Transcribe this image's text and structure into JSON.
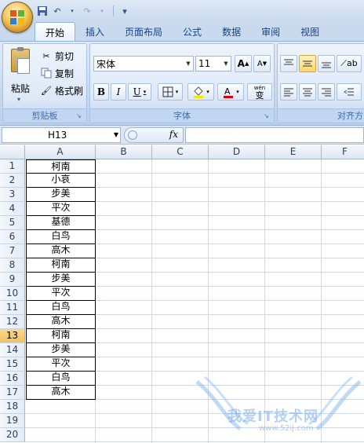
{
  "quick_access": {
    "save": "save-icon",
    "undo": "↶",
    "redo": "↷",
    "customize": "▾"
  },
  "tabs": [
    {
      "label": "开始",
      "active": true
    },
    {
      "label": "插入",
      "active": false
    },
    {
      "label": "页面布局",
      "active": false
    },
    {
      "label": "公式",
      "active": false
    },
    {
      "label": "数据",
      "active": false
    },
    {
      "label": "审阅",
      "active": false
    },
    {
      "label": "视图",
      "active": false
    }
  ],
  "clipboard": {
    "paste": "粘贴",
    "cut": "剪切",
    "copy": "复制",
    "format_painter": "格式刷",
    "title": "剪贴板"
  },
  "font": {
    "name": "宋体",
    "size": "11",
    "title": "字体",
    "grow": "A",
    "shrink": "A",
    "bold": "B",
    "italic": "I",
    "underline": "U",
    "wen": "wén",
    "wen_char": "变"
  },
  "alignment": {
    "title": "对齐方"
  },
  "formula_bar": {
    "name_box": "H13",
    "fx": "fx",
    "formula": ""
  },
  "columns": [
    "A",
    "B",
    "C",
    "D",
    "E",
    "F"
  ],
  "rows": [
    "1",
    "2",
    "3",
    "4",
    "5",
    "6",
    "7",
    "8",
    "9",
    "10",
    "11",
    "12",
    "13",
    "14",
    "15",
    "16",
    "17",
    "18",
    "19",
    "20"
  ],
  "selected_row": "13",
  "cells_A": [
    "柯南",
    "小哀",
    "步美",
    "平次",
    "基德",
    "白鸟",
    "高木",
    "柯南",
    "步美",
    "平次",
    "白鸟",
    "高木",
    "柯南",
    "步美",
    "平次",
    "白鸟",
    "高木"
  ],
  "watermark": {
    "text": "我爱IT技术网",
    "sub": "www.52ij.com"
  },
  "colors": {
    "accent": "#15428b",
    "selection": "#f1c15f",
    "gridline": "#d0d7e5"
  }
}
